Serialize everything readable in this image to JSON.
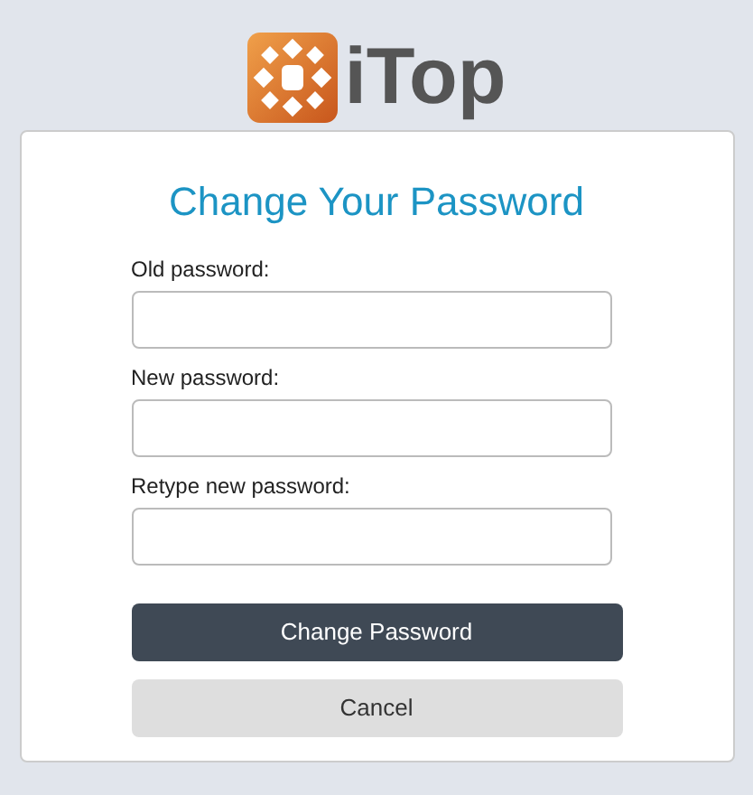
{
  "logo": {
    "text": "iTop"
  },
  "title": "Change Your Password",
  "fields": [
    {
      "label": "Old password:"
    },
    {
      "label": "New password:"
    },
    {
      "label": "Retype new password:"
    }
  ],
  "buttons": [
    {
      "label": "Change Password",
      "kind": "primary"
    },
    {
      "label": "Cancel",
      "kind": "secondary"
    }
  ]
}
